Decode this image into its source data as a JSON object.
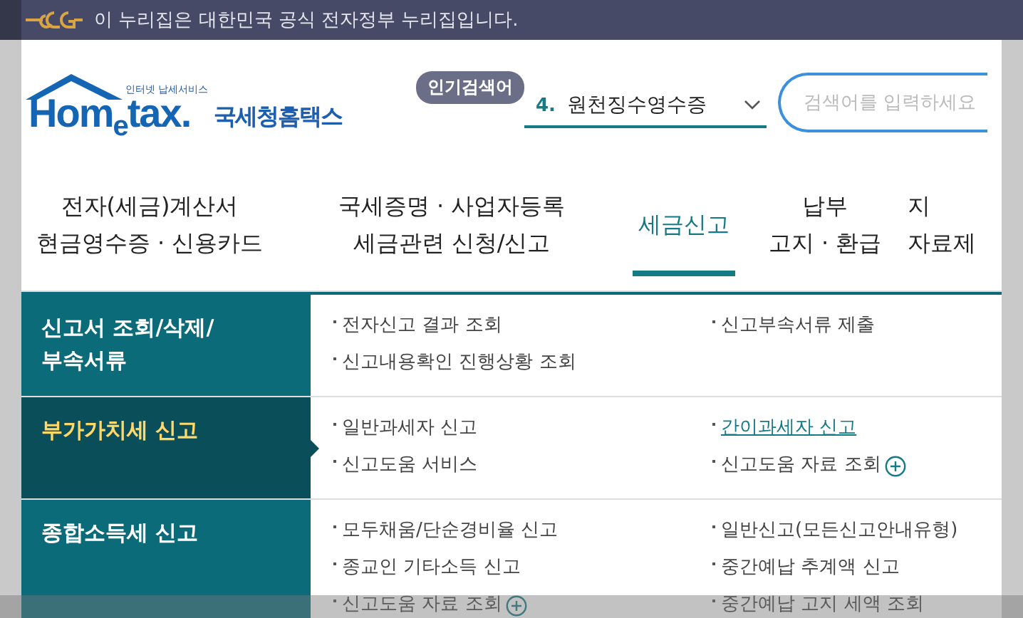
{
  "notice_bar": {
    "text": "이 누리집은 대한민국 공식 전자정부 누리집입니다."
  },
  "logo": {
    "tagline": "인터넷 납세서비스",
    "wordmark": "Hom$_{e}$tax.",
    "name": "국세청홈택스"
  },
  "popular_search": {
    "badge": "인기검색어",
    "rank": "4.",
    "term": "원천징수영수증"
  },
  "search": {
    "placeholder": "검색어를 입력하세요"
  },
  "tabs": [
    {
      "lines": [
        "전자(세금)계산서",
        "현금영수증 · 신용카드"
      ],
      "selected": false
    },
    {
      "lines": [
        "국세증명 · 사업자등록",
        "세금관련 신청/신고"
      ],
      "selected": false
    },
    {
      "lines": [
        "세금신고"
      ],
      "selected": true
    },
    {
      "lines": [
        "납부",
        "고지 · 환급"
      ],
      "selected": false
    },
    {
      "lines": [
        "지",
        "자료제"
      ],
      "selected": false
    }
  ],
  "menu": [
    {
      "title": [
        "신고서 조회/삭제/",
        "부속서류"
      ],
      "selected": false,
      "columns": [
        [
          {
            "label": "전자신고 결과 조회",
            "kind": "plain",
            "plus": false
          },
          {
            "label": "신고내용확인 진행상황 조회",
            "kind": "plain",
            "plus": false
          }
        ],
        [
          {
            "label": "신고부속서류 제출",
            "kind": "plain",
            "plus": false
          }
        ]
      ]
    },
    {
      "title": [
        "부가가치세 신고"
      ],
      "selected": true,
      "columns": [
        [
          {
            "label": "일반과세자 신고",
            "kind": "plain",
            "plus": false
          },
          {
            "label": "신고도움 서비스",
            "kind": "plain",
            "plus": false
          }
        ],
        [
          {
            "label": "간이과세자 신고",
            "kind": "link",
            "plus": false
          },
          {
            "label": "신고도움 자료 조회",
            "kind": "plain",
            "plus": true
          }
        ]
      ]
    },
    {
      "title": [
        "종합소득세 신고"
      ],
      "selected": false,
      "columns": [
        [
          {
            "label": "모두채움/단순경비율 신고",
            "kind": "plain",
            "plus": false
          },
          {
            "label": "종교인 기타소득 신고",
            "kind": "plain",
            "plus": false
          },
          {
            "label": "신고도움 자료 조회",
            "kind": "plain",
            "plus": true
          }
        ],
        [
          {
            "label": "일반신고(모든신고안내유형)",
            "kind": "plain",
            "plus": false
          },
          {
            "label": "중간예납 추계액 신고",
            "kind": "plain",
            "plus": false
          },
          {
            "label": "중간예납 고지 세액 조회",
            "kind": "plain",
            "plus": false
          }
        ]
      ]
    }
  ]
}
